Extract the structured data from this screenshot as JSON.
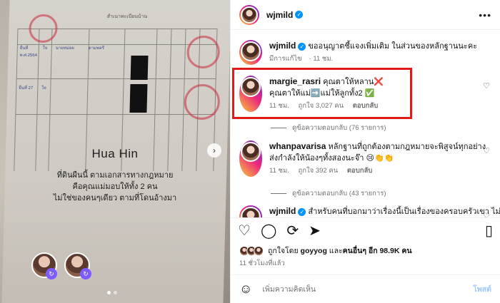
{
  "photo": {
    "paper_title": "สำเนาทะเบียนบ้าน",
    "overlay_title": "Hua Hin",
    "overlay_lines": [
      "ที่ดินผืนนี้ ตามเอกสารทางกฎหมาย",
      "คือคุณแม่มอบให้ทั้ง 2 คน",
      "ไม่ใช่ของคนๆเดียว ตามที่โดนอ้างมา"
    ],
    "handwriting": [
      "ยื่นที่",
      "ยื่นที่",
      "ยื่นที่ 27",
      "พ.ศ.2564",
      "ใจ",
      "ใจ",
      "นายหม่อย",
      "ตามพลรี"
    ],
    "nav_icon": "chevron-right-icon",
    "slide_count": 2,
    "active_slide": 1
  },
  "header": {
    "username": "wjmild",
    "verified_icon": "verified-badge-icon",
    "more_icon": "more-horizontal-icon"
  },
  "comments": [
    {
      "username": "wjmild",
      "verified": true,
      "text": "ขออนุญาตชี้แจงเพิ่มเติม ในส่วนของหลักฐานนะคะ",
      "edited": "มีการแก้ไข",
      "time": "11 ชม.",
      "likes": "",
      "reply_label": ""
    },
    {
      "username": "margie_rasri",
      "text_line1": "คุณตาให้หลาน❌",
      "text_line2": "คุณตาให้แม่➡️แม่ให้ลูกทั้ง2 ✅",
      "time": "11 ชม.",
      "likes": "ถูกใจ 3,027 คน",
      "reply_label": "ตอบกลับ",
      "view_replies": "ดูข้อความตอบกลับ (76 รายการ)"
    },
    {
      "username": "whanpavarisa",
      "text_line1": "หลักฐานที่ถูกต้องตามกฎหมายจะพิสูจน์ทุกอย่าง",
      "text_line2": "ส่งกำลังให้น้องๆทั้งสองนะจ๊า 😢👏👏",
      "time": "11 ชม.",
      "likes": "ถูกใจ 392 คน",
      "reply_label": "ตอบกลับ",
      "view_replies": "ดูข้อความตอบกลับ (43 รายการ)"
    },
    {
      "username": "wjmild",
      "verified": true,
      "text": "สำหรับคนที่บอกมาว่าเรื่องนี้เป็นเรื่องของครอบครัวเขา ไม่"
    }
  ],
  "actions": {
    "like_icon": "heart-icon",
    "comment_icon": "comment-icon",
    "repost_icon": "repost-icon",
    "share_icon": "share-icon",
    "save_icon": "bookmark-icon"
  },
  "likes_summary": {
    "prefix": "ถูกใจโดย",
    "name": "goyyog",
    "middle": "และ",
    "others": "คนอื่นๆ อีก 98.9K คน"
  },
  "post_time": "11 ชั่วโมงที่แล้ว",
  "composer": {
    "placeholder": "เพิ่มความคิดเห็น",
    "post_label": "โพสต์",
    "emoji_icon": "emoji-icon"
  },
  "colors": {
    "highlight": "#e01919",
    "link_blue": "#0095f6",
    "meta_gray": "#737373"
  }
}
